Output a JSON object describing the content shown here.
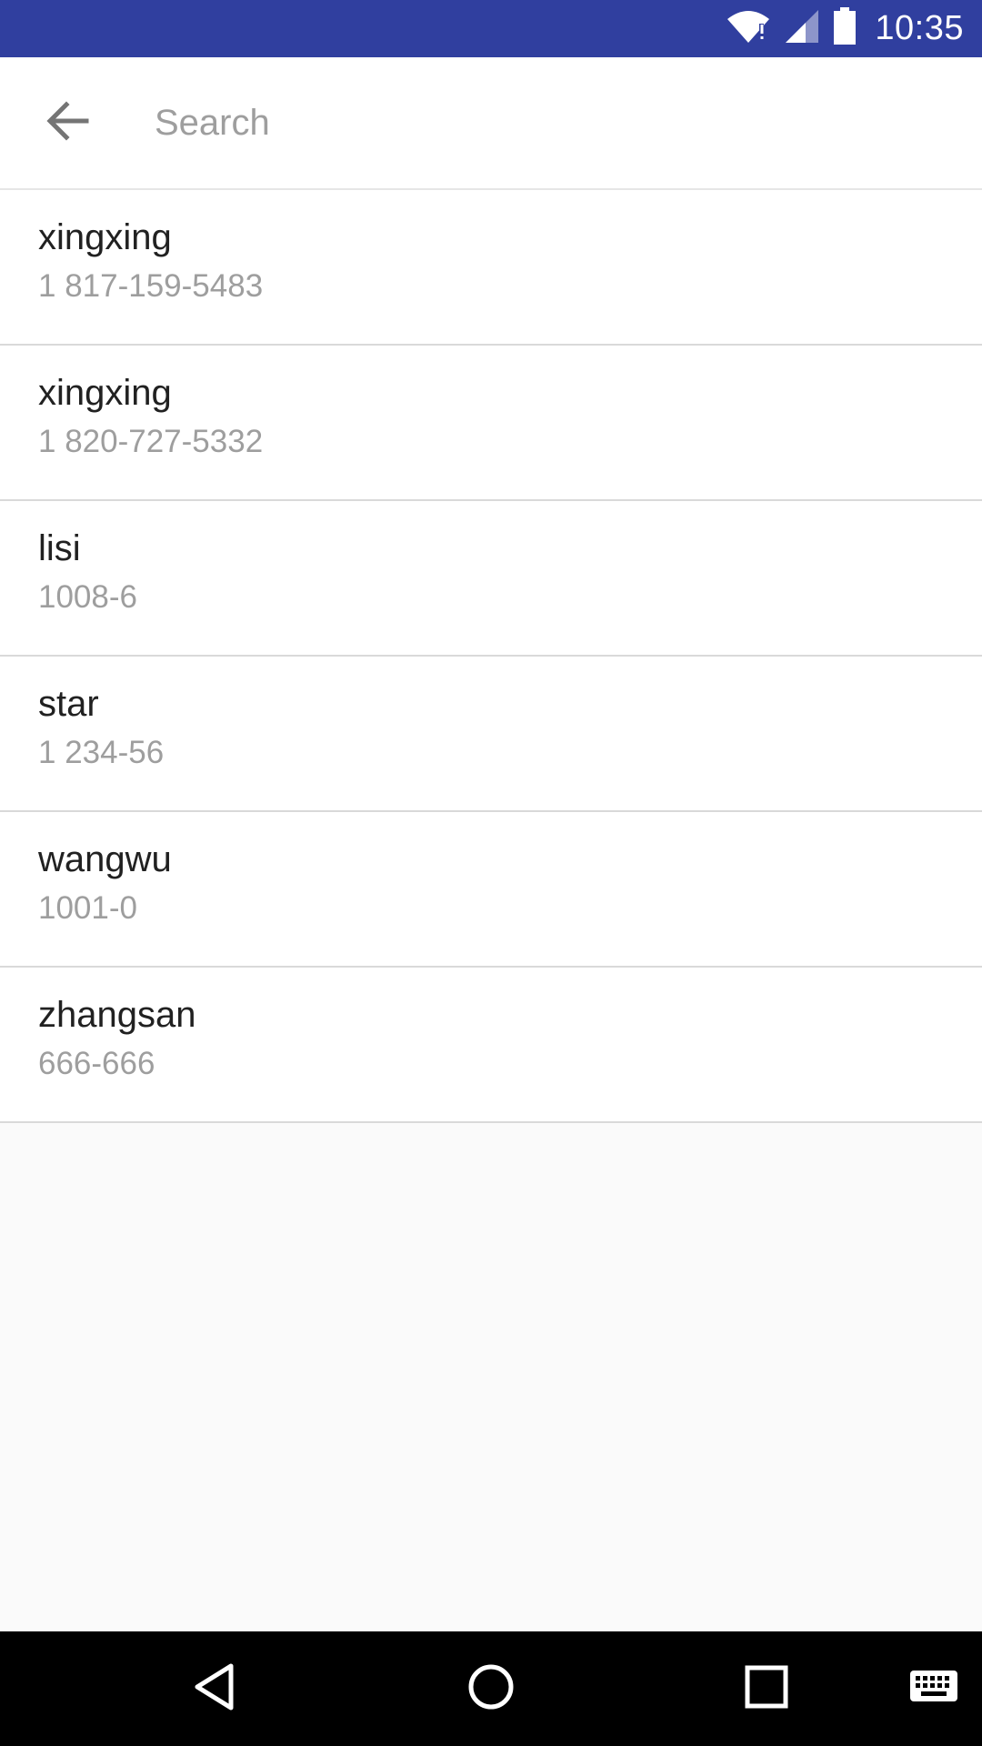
{
  "status_bar": {
    "time": "10:35",
    "background_color": "#303f9f",
    "icons": [
      "wifi-alert-icon",
      "cell-signal-icon",
      "battery-icon"
    ]
  },
  "search": {
    "placeholder": "Search",
    "value": "",
    "back_icon": "arrow-back-icon"
  },
  "contacts": [
    {
      "name": "xingxing",
      "number": "1 817-159-5483"
    },
    {
      "name": "xingxing",
      "number": "1 820-727-5332"
    },
    {
      "name": "lisi",
      "number": "1008-6"
    },
    {
      "name": "star",
      "number": "1 234-56"
    },
    {
      "name": "wangwu",
      "number": "1001-0"
    },
    {
      "name": "zhangsan",
      "number": "666-666"
    }
  ],
  "nav_bar": {
    "buttons": [
      "back-triangle-icon",
      "home-circle-icon",
      "recents-square-icon",
      "keyboard-icon"
    ]
  }
}
